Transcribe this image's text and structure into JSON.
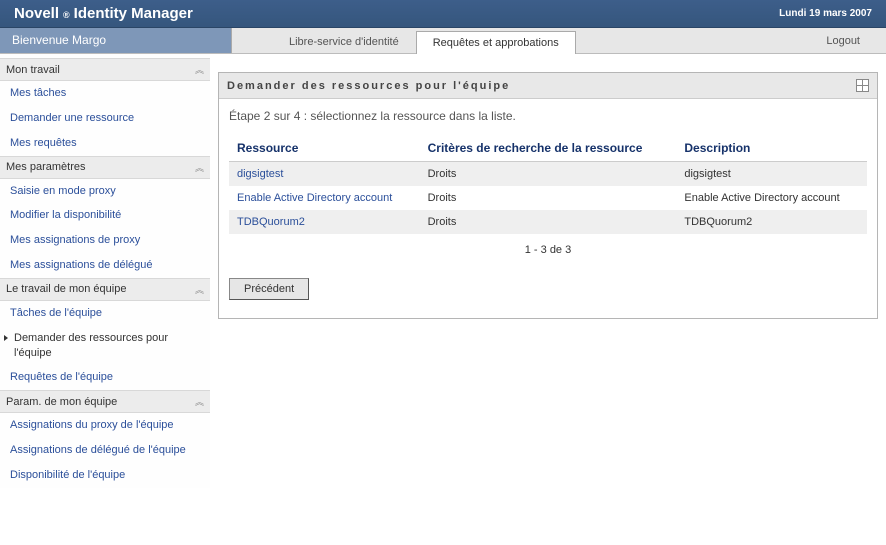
{
  "topbar": {
    "brand_left": "Novell",
    "reg": "®",
    "brand_right": "Identity Manager",
    "date": "Lundi 19 mars 2007"
  },
  "subbar": {
    "welcome": "Bienvenue Margo",
    "tab_self_service": "Libre-service d'identité",
    "tab_requests": "Requêtes et approbations",
    "logout": "Logout"
  },
  "sidebar": {
    "sections": [
      {
        "title": "Mon travail",
        "items": [
          {
            "label": "Mes tâches"
          },
          {
            "label": "Demander une ressource"
          },
          {
            "label": "Mes requêtes"
          }
        ]
      },
      {
        "title": "Mes paramètres",
        "items": [
          {
            "label": "Saisie en mode proxy"
          },
          {
            "label": "Modifier la disponibilité"
          },
          {
            "label": "Mes assignations de proxy"
          },
          {
            "label": "Mes assignations de délégué"
          }
        ]
      },
      {
        "title": "Le travail de mon équipe",
        "items": [
          {
            "label": "Tâches de l'équipe"
          },
          {
            "label": "Demander des ressources pour l'équipe",
            "current": true
          },
          {
            "label": "Requêtes de l'équipe"
          }
        ]
      },
      {
        "title": "Param. de mon équipe",
        "items": [
          {
            "label": "Assignations du proxy de l'équipe"
          },
          {
            "label": "Assignations de délégué de l'équipe"
          },
          {
            "label": "Disponibilité de l'équipe"
          }
        ]
      }
    ]
  },
  "panel": {
    "title": "Demander des ressources pour l'équipe",
    "step": "Étape 2 sur 4 : sélectionnez la ressource dans la liste.",
    "cols": {
      "resource": "Ressource",
      "criteria": "Critères de recherche de la ressource",
      "description": "Description"
    },
    "rows": [
      {
        "resource": "digsigtest",
        "criteria": "Droits",
        "description": "digsigtest"
      },
      {
        "resource": "Enable Active Directory account",
        "criteria": "Droits",
        "description": "Enable Active Directory account"
      },
      {
        "resource": "TDBQuorum2",
        "criteria": "Droits",
        "description": "TDBQuorum2"
      }
    ],
    "pager": "1 - 3 de 3",
    "back_btn": "Précédent"
  }
}
